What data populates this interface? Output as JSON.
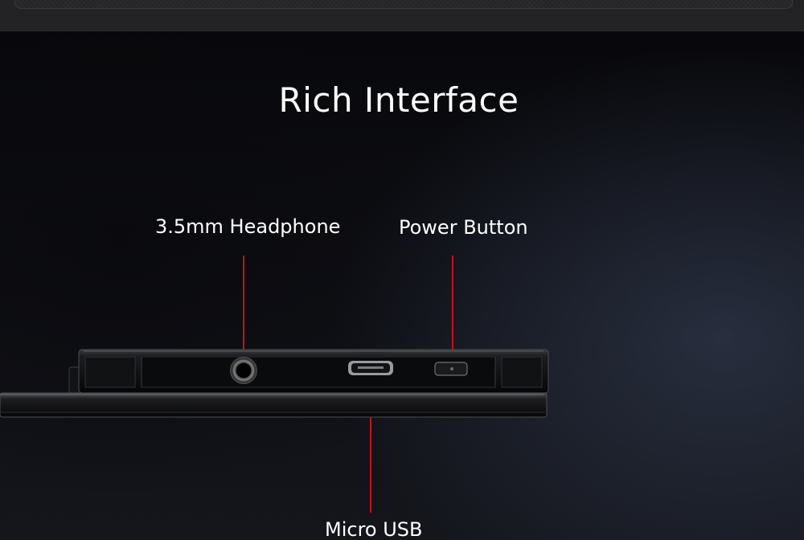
{
  "header": {
    "title": "Rich Interface"
  },
  "callouts": {
    "headphone": "3.5mm Headphone",
    "power": "Power Button",
    "usb": "Micro USB"
  },
  "colors": {
    "accent_line": "#c8101a",
    "text": "#ffffff",
    "background": "#0b0b0e"
  }
}
